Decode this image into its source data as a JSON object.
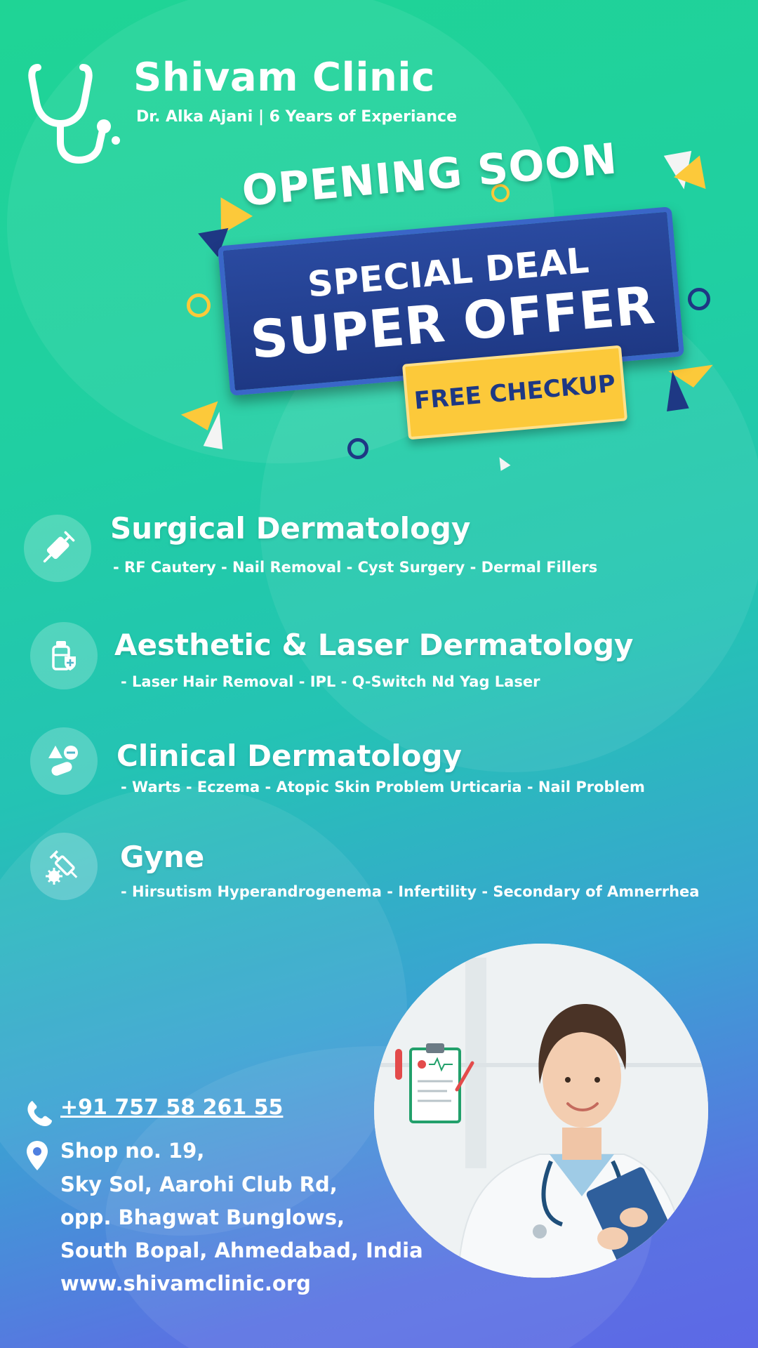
{
  "header": {
    "clinic_name": "Shivam Clinic",
    "doctor_line": "Dr. Alka Ajani | 6 Years of Experiance",
    "logo_icon": "stethoscope-icon"
  },
  "promo": {
    "opening_soon": "OPENING SOON",
    "special_deal": "SPECIAL DEAL",
    "super_offer": "SUPER OFFER",
    "free_checkup": "FREE CHECKUP"
  },
  "services": [
    {
      "title": "Surgical Dermatology",
      "items": "- RF Cautery  - Nail Removal  - Cyst Surgery  - Dermal Fillers",
      "icon": "syringe-icon"
    },
    {
      "title": "Aesthetic & Laser Dermatology",
      "items": "- Laser Hair Removal  - IPL  - Q-Switch Nd Yag Laser",
      "icon": "medicine-bottle-icon"
    },
    {
      "title": "Clinical Dermatology",
      "items": "- Warts  - Eczema - Atopic Skin Problem Urticaria  - Nail Problem",
      "icon": "pills-icon"
    },
    {
      "title": "Gyne",
      "items": "- Hirsutism Hyperandrogenema  - Infertility  - Secondary of Amnerrhea",
      "icon": "syringe-virus-icon"
    }
  ],
  "contact": {
    "phone": "+91 757 58 261 55",
    "address_lines": [
      "Shop no. 19,",
      "Sky Sol, Aarohi Club Rd,",
      "opp. Bhagwat Bunglows,",
      "South Bopal, Ahmedabad, India",
      "www.shivamclinic.org"
    ]
  },
  "colors": {
    "banner_blue": "#1e3884",
    "checkup_yellow": "#fcc93a",
    "gradient_top": "#1fd495",
    "gradient_bottom": "#5d68e6"
  }
}
